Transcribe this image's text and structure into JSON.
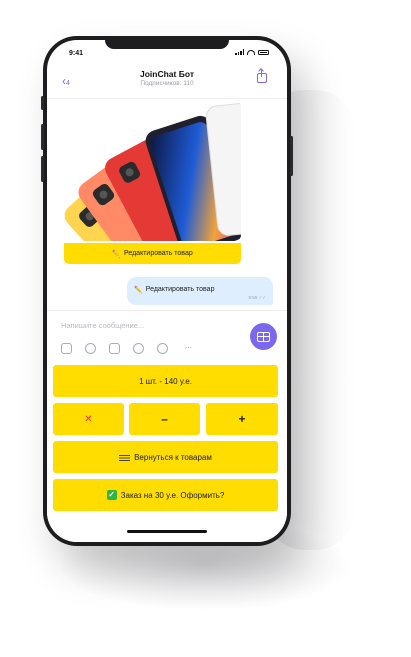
{
  "status": {
    "time": "9:41"
  },
  "header": {
    "back_count": "4",
    "title": "JoinChat Бот",
    "subtitle": "Подписчиков: 110"
  },
  "chat": {
    "edit_button_label": "Редактировать товар",
    "pencil_emoji": "✏️",
    "message_text": "Редактировать товар",
    "message_time": "9:58 ✓✓"
  },
  "composer": {
    "placeholder": "Напишите сообщение..."
  },
  "keyboard": {
    "quantity_price": "1 шт. - 140 у.е.",
    "remove": "✕",
    "minus": "–",
    "plus": "+",
    "back_to_products": "Вернуться к товарам",
    "checkout": "Заказ на 30 у.е. Оформить?"
  },
  "colors": {
    "accent": "#7b68ee",
    "button_yellow": "#ffdd00",
    "bubble_blue": "#dfeeff",
    "remove_red": "#e53935",
    "check_green": "#2fb344"
  },
  "product_image": {
    "phone_colors": [
      "#ffd54f",
      "#ff8a65",
      "#e53935",
      "#1f1f2e",
      "#f5f5f5"
    ]
  }
}
